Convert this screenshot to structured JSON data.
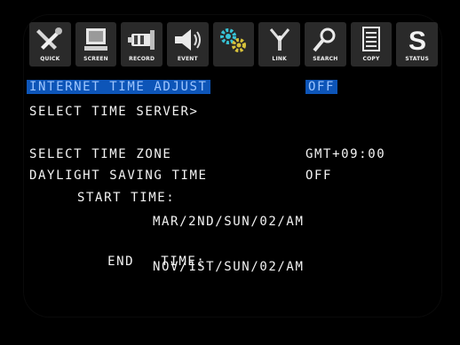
{
  "toolbar": {
    "items": [
      {
        "label": "QUICK",
        "icon": "tools-icon"
      },
      {
        "label": "SCREEN",
        "icon": "monitor-icon"
      },
      {
        "label": "RECORD",
        "icon": "camera-icon"
      },
      {
        "label": "EVENT",
        "icon": "speaker-icon"
      },
      {
        "label": "",
        "icon": "gears-icon"
      },
      {
        "label": "LINK",
        "icon": "antenna-icon"
      },
      {
        "label": "SEARCH",
        "icon": "magnifier-icon"
      },
      {
        "label": "COPY",
        "icon": "document-icon"
      },
      {
        "label": "STATUS",
        "icon": "status-s-icon"
      }
    ]
  },
  "settings": {
    "internet_time_adjust": {
      "label": "INTERNET TIME ADJUST",
      "value": "OFF"
    },
    "select_time_server": {
      "label": "SELECT TIME SERVER>"
    },
    "select_time_zone": {
      "label": "SELECT TIME ZONE",
      "value": "GMT+09:00"
    },
    "daylight_saving": {
      "label": "DAYLIGHT SAVING TIME",
      "value": "OFF"
    },
    "start_time": {
      "label": "START TIME:",
      "value": "MAR/2ND/SUN/02/AM"
    },
    "end_time": {
      "label": "END   TIME:",
      "value": "NOV/1ST/SUN/02/AM"
    }
  },
  "colors": {
    "highlight": "#0d55b8",
    "text": "#f4f4f4",
    "background": "#000000"
  }
}
